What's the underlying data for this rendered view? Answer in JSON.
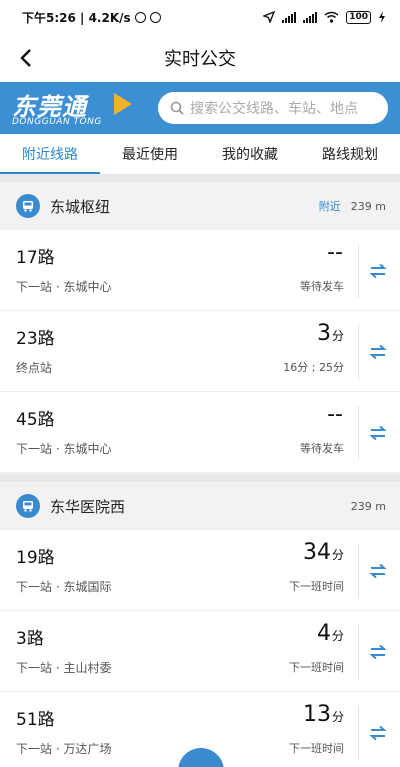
{
  "status_bar": {
    "time_speed": "下午5:26 | 4.2K/s",
    "battery": "100"
  },
  "header": {
    "title": "实时公交"
  },
  "banner": {
    "logo_text": "东莞通",
    "logo_sub": "DONGGUAN TONG",
    "search_placeholder": "搜索公交线路、车站、地点"
  },
  "tabs": [
    {
      "label": "附近线路",
      "active": true
    },
    {
      "label": "最近使用",
      "active": false
    },
    {
      "label": "我的收藏",
      "active": false
    },
    {
      "label": "路线规划",
      "active": false
    }
  ],
  "stations": [
    {
      "name": "东城枢纽",
      "nearby_tag": "附近",
      "distance": "239 m",
      "routes": [
        {
          "name": "17路",
          "next": "下一站 · 东城中心",
          "eta": "--",
          "eta_unit": "",
          "note": "等待发车"
        },
        {
          "name": "23路",
          "next": "终点站",
          "eta": "3",
          "eta_unit": "分",
          "note": "16分 ; 25分"
        },
        {
          "name": "45路",
          "next": "下一站 · 东城中心",
          "eta": "--",
          "eta_unit": "",
          "note": "等待发车"
        }
      ]
    },
    {
      "name": "东华医院西",
      "nearby_tag": "",
      "distance": "239 m",
      "routes": [
        {
          "name": "19路",
          "next": "下一站 · 东城国际",
          "eta": "34",
          "eta_unit": "分",
          "note": "下一班时间"
        },
        {
          "name": "3路",
          "next": "下一站 · 主山村委",
          "eta": "4",
          "eta_unit": "分",
          "note": "下一班时间"
        },
        {
          "name": "51路",
          "next": "下一站 · 万达广场",
          "eta": "13",
          "eta_unit": "分",
          "note": "下一班时间"
        }
      ]
    }
  ],
  "colors": {
    "accent": "#2e86d0",
    "banner": "#3d8fd3",
    "logo_play": "#f6b12c"
  }
}
